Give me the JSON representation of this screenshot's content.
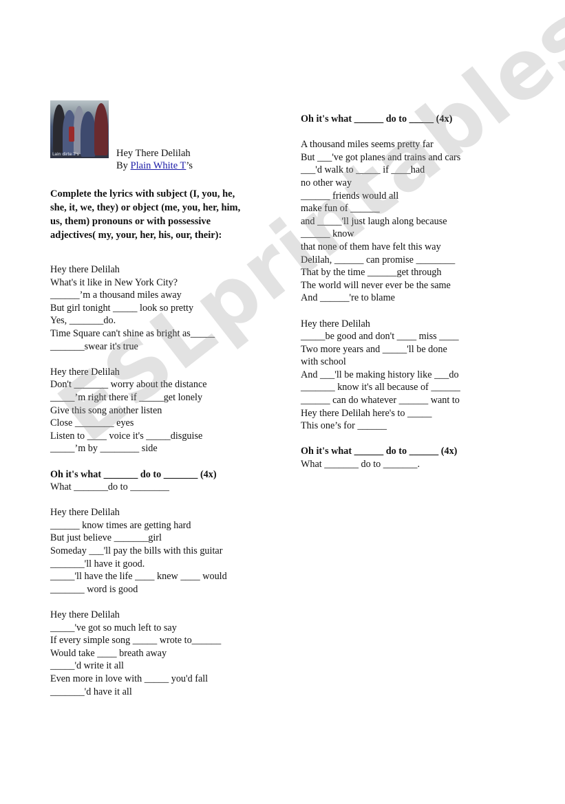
{
  "header": {
    "song_title": "Hey There Delilah",
    "by_prefix": "By ",
    "band_link": "Plain White T",
    "band_suffix": "’s",
    "photo_caption": "Lain dirte T's",
    "photo_icon": "band-photo"
  },
  "instructions": "Complete the lyrics with subject (I, you, he, she, it, we, they) or object (me, you, her, him, us, them) pronouns or with possessive adjectives( my, your, her, his, our, their):",
  "left_column": [
    {
      "text": "Hey there Delilah"
    },
    {
      "text": "What's it like in New York City?"
    },
    {
      "text": "______’m a thousand miles away"
    },
    {
      "text": "But girl tonight _____ look so pretty"
    },
    {
      "text": "Yes, _______do."
    },
    {
      "text": "Time Square can't shine as bright as_____"
    },
    {
      "text": "_______swear it's true"
    },
    {
      "text": ""
    },
    {
      "text": "Hey there Delilah"
    },
    {
      "text": "Don't _______ worry about the distance"
    },
    {
      "text": "_____’m right there if _____get lonely"
    },
    {
      "text": "Give this song another listen"
    },
    {
      "text": "Close ________ eyes"
    },
    {
      "text": "Listen to ____ voice it's _____disguise"
    },
    {
      "text": "_____’m by ________ side"
    },
    {
      "text": ""
    },
    {
      "text": "Oh it's what _______ do to _______ (4x)",
      "bold": true
    },
    {
      "text": "What _______do to ________"
    },
    {
      "text": ""
    },
    {
      "text": "Hey there Delilah"
    },
    {
      "text": "______ know times are getting hard"
    },
    {
      "text": "But just believe _______girl"
    },
    {
      "text": "Someday ___'ll pay the bills with this guitar"
    },
    {
      "text": "_______'ll have it good."
    },
    {
      "text": "_____'ll have the life ____ knew ____ would"
    },
    {
      "text": "_______ word is good"
    },
    {
      "text": ""
    },
    {
      "text": "Hey there Delilah"
    },
    {
      "text": "_____'ve got so much left to say"
    },
    {
      "text": "If every simple song _____ wrote to______"
    },
    {
      "text": "Would take ____ breath away"
    },
    {
      "text": "_____'d write it all"
    },
    {
      "text": "Even more in love with _____ you'd fall"
    },
    {
      "text": "_______'d have it all"
    }
  ],
  "right_column": [
    {
      "text": "Oh it's what ______ do to _____ (4x)",
      "bold": true
    },
    {
      "text": ""
    },
    {
      "text": "A thousand miles seems pretty far"
    },
    {
      "text": "But ___'ve got planes and trains and cars"
    },
    {
      "text": "___'d walk to _____ if ____had"
    },
    {
      "text": "no other way"
    },
    {
      "text": "______ friends would all"
    },
    {
      "text": "make fun of ______"
    },
    {
      "text": "and _____'ll just laugh along because"
    },
    {
      "text": "______ know"
    },
    {
      "text": "that none of them have felt this way"
    },
    {
      "text": "Delilah, ______ can promise ________"
    },
    {
      "text": "That by the time ______get through"
    },
    {
      "text": "The world will never ever be the same"
    },
    {
      "text": "And ______'re to blame"
    },
    {
      "text": ""
    },
    {
      "text": "Hey there Delilah"
    },
    {
      "text": "_____be good and don't ____ miss ____"
    },
    {
      "text": "Two more years and _____'ll be done"
    },
    {
      "text": "with school"
    },
    {
      "text": "And ___'ll be making history like ___do"
    },
    {
      "text": "_______ know it's all because of ______"
    },
    {
      "text": "______ can do whatever ______ want to"
    },
    {
      "text": "Hey there Delilah here's to _____"
    },
    {
      "text": "This one’s for ______"
    },
    {
      "text": ""
    },
    {
      "text": "Oh it's what ______ do to ______ (4x)",
      "bold": true
    },
    {
      "text": "What _______ do to _______."
    }
  ],
  "watermark": "ESLprintables.com"
}
